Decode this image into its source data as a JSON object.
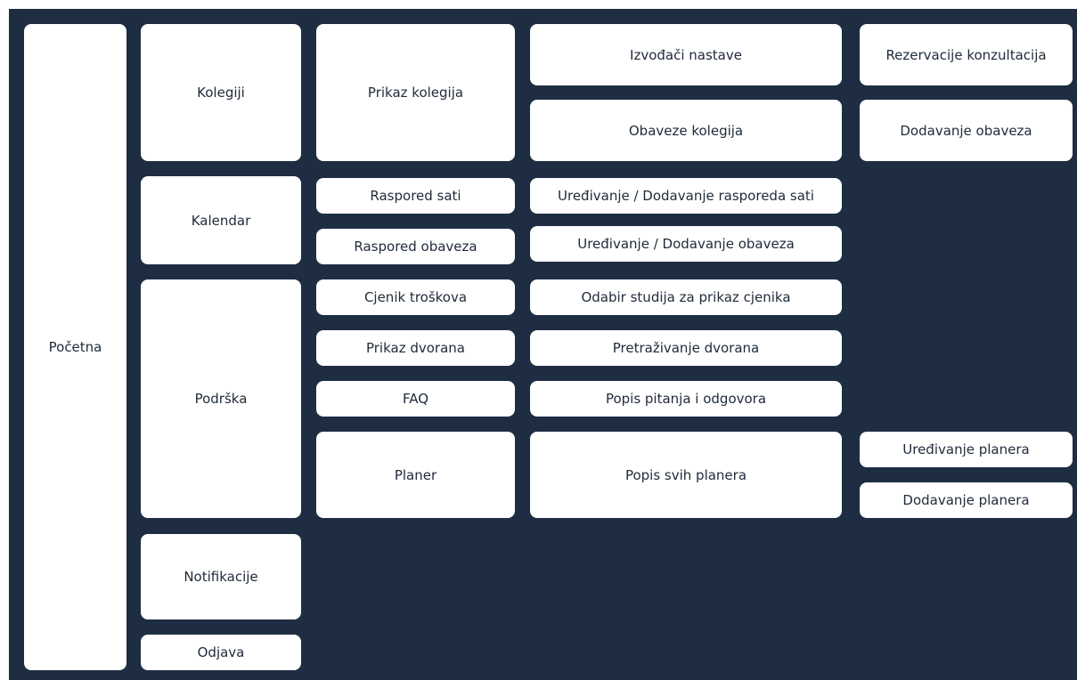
{
  "colors": {
    "background": "#1e2d42",
    "box": "#ffffff",
    "text": "#1f2a3a"
  },
  "sitemap": {
    "root": "Početna",
    "sections": {
      "kolegiji": {
        "label": "Kolegiji",
        "prikaz_kolegija": {
          "label": "Prikaz kolegija",
          "izvodjaci_nastave": "Izvođači nastave",
          "obaveze_kolegija": "Obaveze kolegija",
          "rezervacije_konzultacija": "Rezervacije konzultacija",
          "dodavanje_obaveza": "Dodavanje obaveza"
        }
      },
      "kalendar": {
        "label": "Kalendar",
        "raspored_sati": "Raspored sati",
        "uredjivanje_rasporeda_sati": "Uređivanje / Dodavanje rasporeda sati",
        "raspored_obaveza": "Raspored obaveza",
        "uredjivanje_obaveza": "Uređivanje / Dodavanje obaveza"
      },
      "podrska": {
        "label": "Podrška",
        "cjenik_troskova": "Cjenik troškova",
        "odabir_studija": "Odabir studija za prikaz cjenika",
        "prikaz_dvorana": "Prikaz dvorana",
        "pretrazivanje_dvorana": "Pretraživanje dvorana",
        "faq": "FAQ",
        "popis_pitanja": "Popis pitanja i odgovora",
        "planer": {
          "label": "Planer",
          "popis_svih_planera": "Popis svih planera",
          "uredjivanje_planera": "Uređivanje planera",
          "dodavanje_planera": "Dodavanje planera"
        }
      },
      "notifikacije": "Notifikacije",
      "odjava": "Odjava"
    }
  }
}
